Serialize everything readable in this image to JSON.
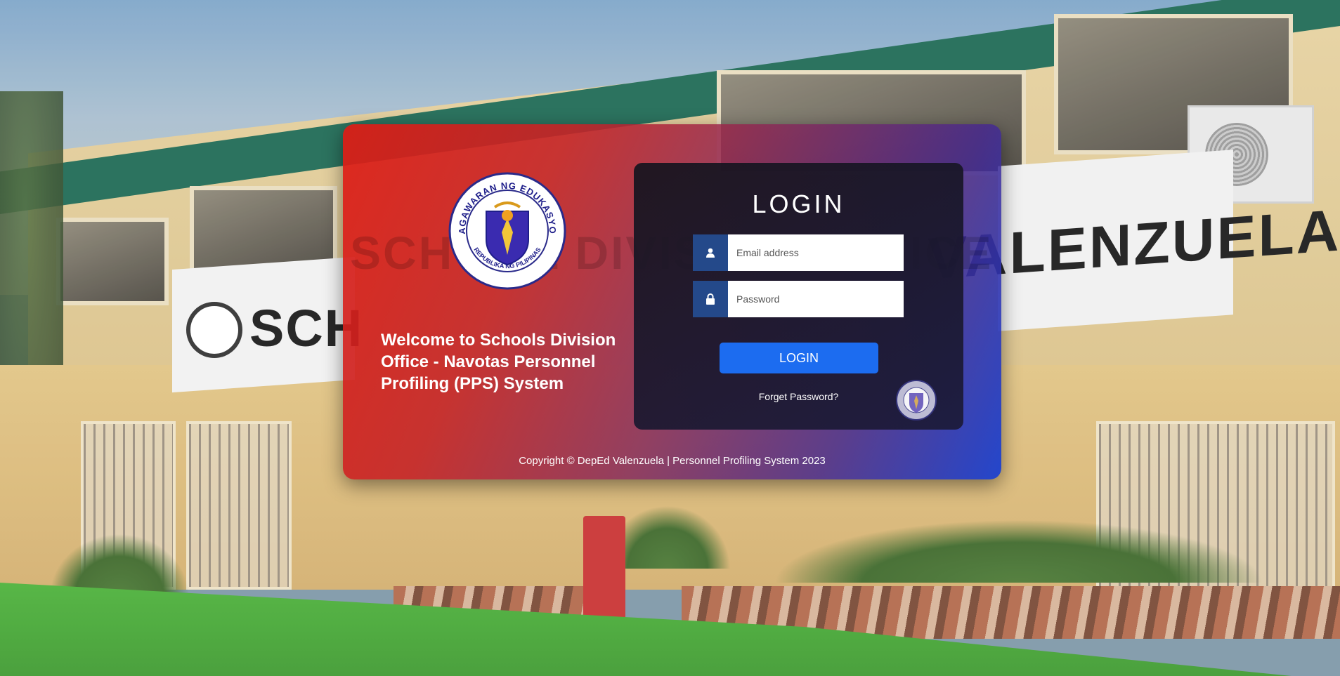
{
  "background": {
    "sign_left": "SCH",
    "sign_right": "VALENZUELA",
    "watermark": "SCHOOL DIVISION OFFICE"
  },
  "card": {
    "seal_alt": "Kagawaran ng Edukasyon seal",
    "seal_top_text": "KAGAWARAN NG EDUKASYON",
    "seal_bottom_text": "REPUBLIKA NG PILIPINAS",
    "welcome_text": "Welcome to Schools Division Office - Navotas Personnel Profiling (PPS) System",
    "copyright": "Copyright © DepEd Valenzuela | Personnel Profiling System 2023"
  },
  "login": {
    "title": "LOGIN",
    "email_placeholder": "Email address",
    "email_value": "",
    "password_placeholder": "Password",
    "password_value": "",
    "button_label": "LOGIN",
    "forget_link": "Forget Password?"
  },
  "icons": {
    "email": "user-icon",
    "password": "lock-icon"
  },
  "colors": {
    "gradient_start": "#de1c14",
    "gradient_end": "#143cd2",
    "panel": "#16141e",
    "field_icon": "#24498a",
    "button": "#1c6cf0"
  }
}
